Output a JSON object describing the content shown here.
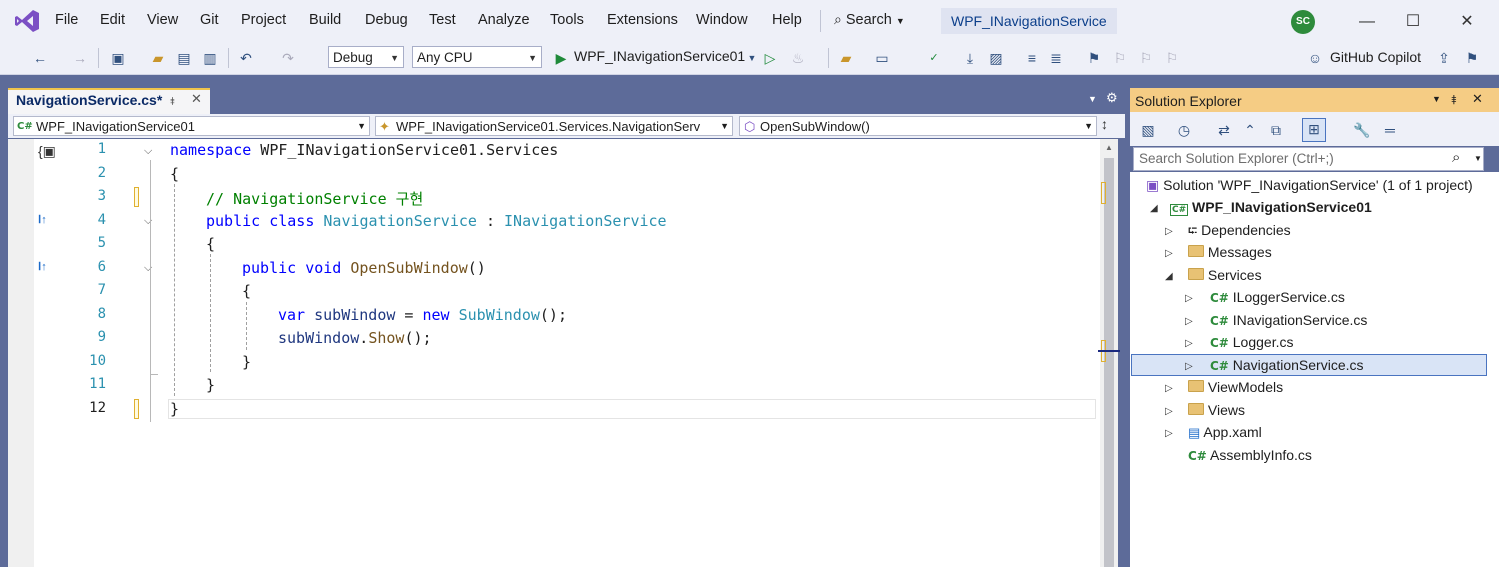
{
  "menu": {
    "items": [
      "File",
      "Edit",
      "View",
      "Git",
      "Project",
      "Build",
      "Debug",
      "Test",
      "Analyze",
      "Tools",
      "Extensions",
      "Window",
      "Help"
    ],
    "search_label": "Search",
    "title": "WPF_INavigationService",
    "avatar_initials": "SC"
  },
  "toolbar": {
    "configuration": "Debug",
    "platform": "Any CPU",
    "run_target": "WPF_INavigationService01",
    "copilot_label": "GitHub Copilot"
  },
  "editor": {
    "tab_label": "NavigationService.cs*",
    "nav_project": "WPF_INavigationService01",
    "nav_class": "WPF_INavigationService01.Services.NavigationServ",
    "nav_member": "OpenSubWindow()",
    "line_numbers": [
      "1",
      "2",
      "3",
      "4",
      "5",
      "6",
      "7",
      "8",
      "9",
      "10",
      "11",
      "12"
    ],
    "current_line": "12",
    "code": {
      "l1_kw": "namespace",
      "l1_rest": " WPF_INavigationService01.Services",
      "l2": "{",
      "l3_comment": "// NavigationService 구현",
      "l4_public": "public",
      "l4_class": "class",
      "l4_name": "NavigationService",
      "l4_colon": " : ",
      "l4_iface": "INavigationService",
      "l5": "{",
      "l6_public": "public",
      "l6_void": "void",
      "l6_name": "OpenSubWindow",
      "l6_parens": "()",
      "l7": "{",
      "l8_var": "var",
      "l8_name": "subWindow",
      "l8_eq": " = ",
      "l8_new": "new",
      "l8_type": "SubWindow",
      "l8_end": "();",
      "l9_obj": "subWindow",
      "l9_dot": ".",
      "l9_method": "Show",
      "l9_end": "();",
      "l10": "}",
      "l11": "}",
      "l12": "}"
    }
  },
  "solution_explorer": {
    "title": "Solution Explorer",
    "search_placeholder": "Search Solution Explorer (Ctrl+;)",
    "solution_label": "Solution 'WPF_INavigationService' (1 of 1 project)",
    "project": "WPF_INavigationService01",
    "items": {
      "dependencies": "Dependencies",
      "messages": "Messages",
      "services": "Services",
      "ilogger": "ILoggerService.cs",
      "inavigation": "INavigationService.cs",
      "logger": "Logger.cs",
      "navigation": "NavigationService.cs",
      "viewmodels": "ViewModels",
      "views": "Views",
      "app": "App.xaml",
      "assembly": "AssemblyInfo.cs"
    },
    "cs_badge": "C#"
  },
  "colors": {
    "accent_chrome": "#5d6b99",
    "tool_header": "#f5cc84",
    "keyword": "#0000ff",
    "type": "#2b91af",
    "comment": "#008000"
  }
}
